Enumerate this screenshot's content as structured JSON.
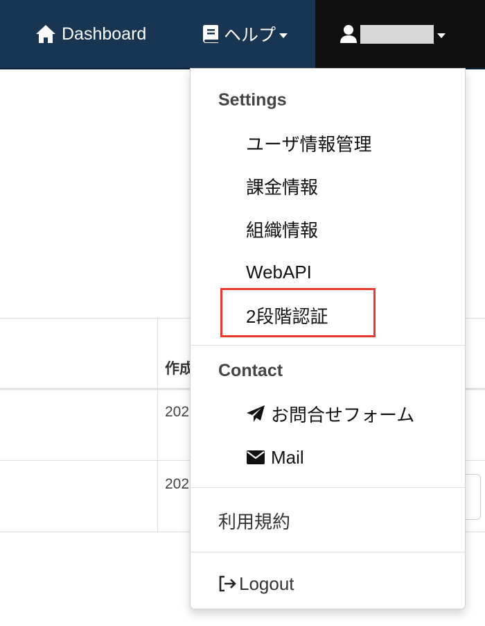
{
  "navbar": {
    "dashboard_label": "Dashboard",
    "help_label": "ヘルプ",
    "bg_color": "#183552",
    "user_bg_color": "#111111"
  },
  "background_table": {
    "header_partial": "作成",
    "row1_value_partial": "202",
    "row2_value_partial": "202"
  },
  "dropdown": {
    "settings_header": "Settings",
    "settings_items": [
      {
        "label": "ユーザ情報管理"
      },
      {
        "label": "課金情報"
      },
      {
        "label": "組織情報"
      },
      {
        "label": "WebAPI"
      },
      {
        "label": "2段階認証"
      }
    ],
    "contact_header": "Contact",
    "contact_items": [
      {
        "label": "お問合せフォーム",
        "icon": "paper-plane-icon"
      },
      {
        "label": "Mail",
        "icon": "envelope-icon"
      }
    ],
    "terms_label": "利用規約",
    "logout_label": "Logout",
    "highlight_color": "#e8392b"
  }
}
